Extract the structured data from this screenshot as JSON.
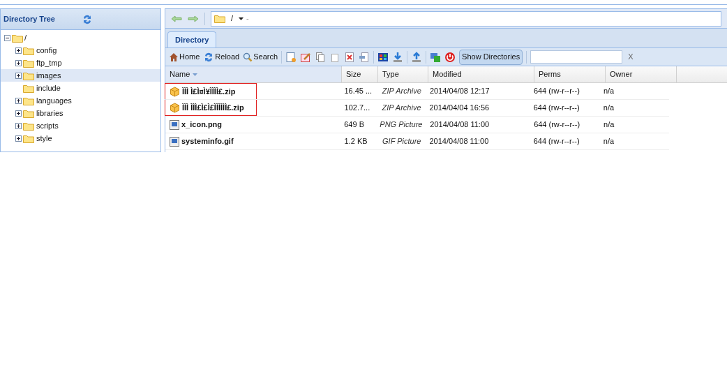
{
  "tree": {
    "title": "Directory Tree",
    "root": {
      "label": "/",
      "expanded": true,
      "children": [
        {
          "label": "config",
          "has_children": true,
          "selected": false
        },
        {
          "label": "ftp_tmp",
          "has_children": true,
          "selected": false
        },
        {
          "label": "images",
          "has_children": true,
          "selected": true
        },
        {
          "label": "include",
          "has_children": false,
          "selected": false
        },
        {
          "label": "languages",
          "has_children": true,
          "selected": false
        },
        {
          "label": "libraries",
          "has_children": true,
          "selected": false
        },
        {
          "label": "scripts",
          "has_children": true,
          "selected": false
        },
        {
          "label": "style",
          "has_children": true,
          "selected": false
        }
      ]
    }
  },
  "path": {
    "value": "/",
    "separator": "-"
  },
  "tabs": [
    {
      "label": "Directory",
      "selected": true
    }
  ],
  "toolbar": {
    "buttons": [
      {
        "kind": "home",
        "label": "Home"
      },
      {
        "kind": "reload",
        "label": "Reload"
      },
      {
        "kind": "search",
        "label": "Search"
      }
    ],
    "show_directories": {
      "label": "Show Directories",
      "on": true
    },
    "clear": "X"
  },
  "table": {
    "columns": [
      {
        "label": "Name",
        "sorted": true
      },
      {
        "label": "Size",
        "sorted": false
      },
      {
        "label": "Type",
        "sorted": false
      },
      {
        "label": "Modified",
        "sorted": false
      },
      {
        "label": "Perms",
        "sorted": false
      },
      {
        "label": "Owner",
        "sorted": false
      }
    ],
    "rows": [
      {
        "kind": "archive",
        "name": "ÌÌÌ Ì£Ì¤Ì¥ÌÌÌÌ£.zip",
        "size": "16.45 ...",
        "type": "ZIP Archive",
        "modified": "2014/04/08 12:17",
        "perms": "644 (rw-r--r--)",
        "owner": "n/a",
        "selected": true
      },
      {
        "kind": "archive",
        "name": "ÌÌÌ ÌÌÌ£Ì£Ì£ÌÌÌÌÌÌ£.zip",
        "size": "102.7...",
        "type": "ZIP Archive",
        "modified": "2014/04/04 16:56",
        "perms": "644 (rw-r--r--)",
        "owner": "n/a",
        "selected": true
      },
      {
        "kind": "image",
        "name": "x_icon.png",
        "size": "649 B",
        "type": "PNG Picture",
        "modified": "2014/04/08 11:00",
        "perms": "644 (rw-r--r--)",
        "owner": "n/a",
        "selected": false
      },
      {
        "kind": "image",
        "name": "systeminfo.gif",
        "size": "1.2 KB",
        "type": "GIF Picture",
        "modified": "2014/04/08 11:00",
        "perms": "644 (rw-r--r--)",
        "owner": "n/a",
        "selected": false
      }
    ]
  }
}
